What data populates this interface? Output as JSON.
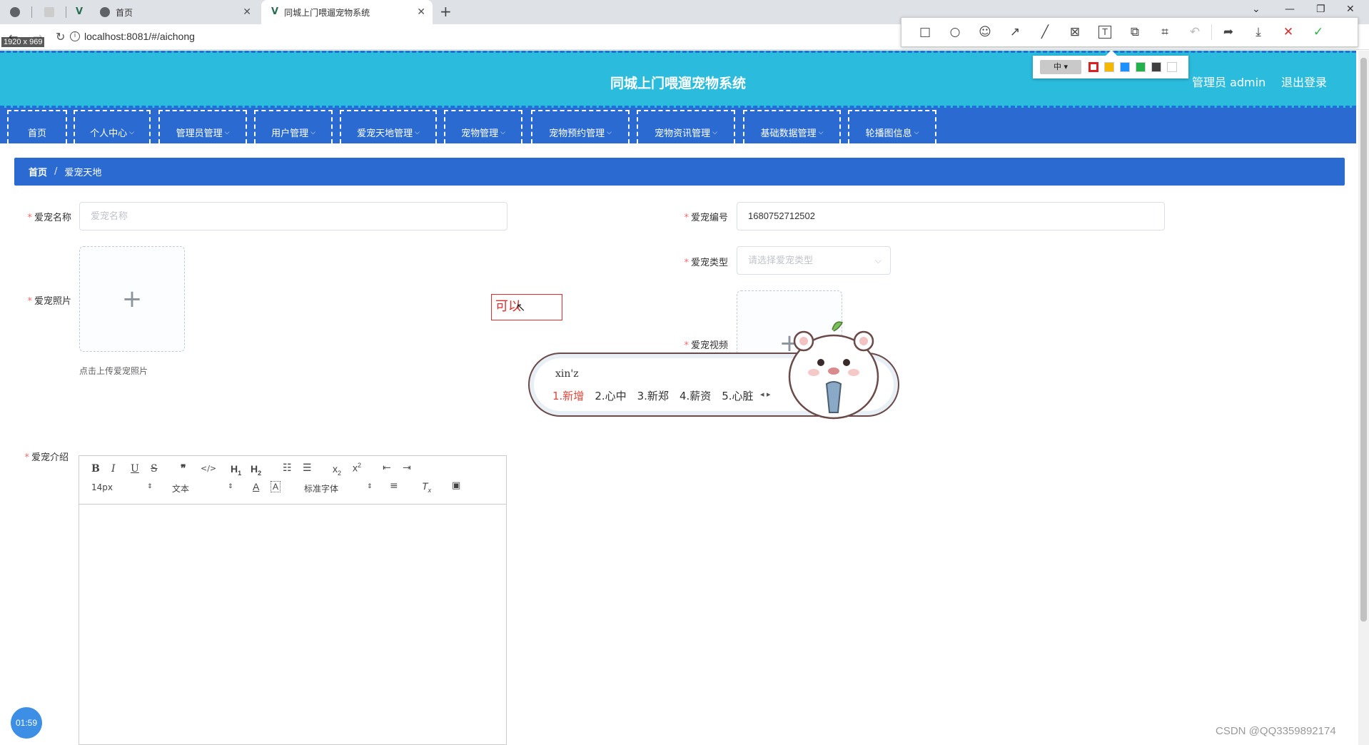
{
  "browser": {
    "tabs": [
      {
        "title": ""
      },
      {
        "title": ""
      },
      {
        "title": "首页"
      },
      {
        "title": "同城上门喂遛宠物系统"
      }
    ],
    "url": "localhost:8081/#/aichong",
    "dimension_label": "1920 x 969"
  },
  "screenshot_tool": {
    "tools": [
      "rectangle-icon",
      "ellipse-icon",
      "emoji-icon",
      "arrow-icon",
      "pen-icon",
      "mosaic-icon",
      "text-icon",
      "pin-icon",
      "ocr-icon",
      "undo-icon",
      "share-icon",
      "save-icon",
      "close-icon",
      "confirm-icon"
    ],
    "font_size_label": "中 ▾",
    "colors": [
      "#e02020",
      "#f5b800",
      "#1e90ff",
      "#22b14c",
      "#404040",
      "#ffffff"
    ]
  },
  "header": {
    "title": "同城上门喂遛宠物系统",
    "admin_label": "管理员 admin",
    "logout_label": "退出登录"
  },
  "nav": [
    {
      "label": "首页",
      "dropdown": false
    },
    {
      "label": "个人中心",
      "dropdown": true
    },
    {
      "label": "管理员管理",
      "dropdown": true
    },
    {
      "label": "用户管理",
      "dropdown": true
    },
    {
      "label": "爱宠天地管理",
      "dropdown": true
    },
    {
      "label": "宠物管理",
      "dropdown": true
    },
    {
      "label": "宠物预约管理",
      "dropdown": true
    },
    {
      "label": "宠物资讯管理",
      "dropdown": true
    },
    {
      "label": "基础数据管理",
      "dropdown": true
    },
    {
      "label": "轮播图信息",
      "dropdown": true
    }
  ],
  "breadcrumb": {
    "home": "首页",
    "separator": "/",
    "current": "爱宠天地"
  },
  "form": {
    "required_mark": "*",
    "name_label": "爱宠名称",
    "name_placeholder": "爱宠名称",
    "number_label": "爱宠编号",
    "number_value": "1680752712502",
    "photo_label": "爱宠照片",
    "photo_tip": "点击上传爱宠照片",
    "type_label": "爱宠类型",
    "type_placeholder": "请选择爱宠类型",
    "video_label": "爱宠视频",
    "intro_label": "爱宠介绍",
    "upload_plus": "+"
  },
  "editor": {
    "size_select": "14px",
    "header_select": "文本",
    "font_select": "标准字体"
  },
  "annotation_text": "可以",
  "ime": {
    "pinyin": "xin'z",
    "candidates": [
      "1.新增",
      "2.心中",
      "3.新郑",
      "4.薪资",
      "5.心脏"
    ]
  },
  "timer": "01:59",
  "watermark": "CSDN @QQ3359892174"
}
